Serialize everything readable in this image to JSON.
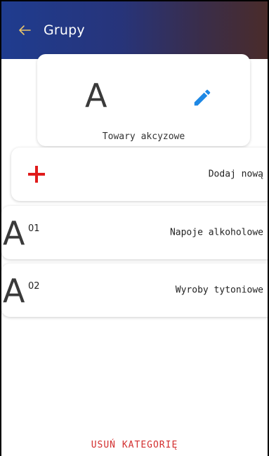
{
  "appbar": {
    "title": "Grupy",
    "back_icon": "arrow-left-icon",
    "back_icon_color": "#e9c46a"
  },
  "category": {
    "letter": "A",
    "name": "Towary akcyzowe",
    "edit_icon": "pencil-icon",
    "edit_icon_color": "#1e88e5"
  },
  "add_row": {
    "icon": "plus-icon",
    "icon_color": "#e01b1b",
    "label": "Dodaj nową"
  },
  "groups": [
    {
      "letter": "A",
      "code": "01",
      "name": "Napoje alkoholowe"
    },
    {
      "letter": "A",
      "code": "02",
      "name": "Wyroby tytoniowe"
    }
  ],
  "footer": {
    "delete_label": "USUŃ KATEGORIĘ",
    "delete_color": "#d32f2f"
  }
}
